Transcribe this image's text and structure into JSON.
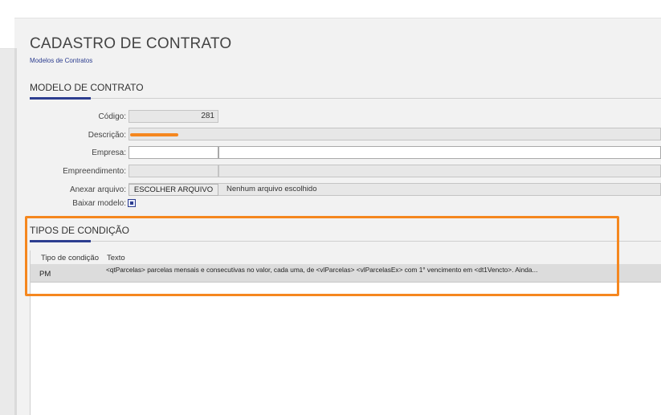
{
  "page": {
    "title": "CADASTRO DE CONTRATO",
    "breadcrumb": "Modelos de Contratos"
  },
  "modelo": {
    "section_title": "MODELO DE CONTRATO",
    "codigo_label": "Código:",
    "codigo_value": "281",
    "descricao_label": "Descrição:",
    "empresa_label": "Empresa:",
    "empreendimento_label": "Empreendimento:",
    "anexar_label": "Anexar arquivo:",
    "escolher_button": "ESCOLHER ARQUIVO",
    "file_status": "Nenhum arquivo escolhido",
    "baixar_label": "Baixar modelo:"
  },
  "tipos": {
    "section_title": "TIPOS DE CONDIÇÃO",
    "columns": [
      "Tipo de condição",
      "Texto"
    ],
    "rows": [
      {
        "tipo": "PM",
        "texto": "<qtParcelas> parcelas mensais e consecutivas no valor, cada uma, de <vlParcelas> <vlParcelasEx> com 1° vencimento em <dt1Vencto>. Ainda..."
      }
    ]
  },
  "colors": {
    "accent": "#2c3d8f",
    "highlight": "#f5871f",
    "redaction": "#f5871f"
  },
  "icons": {
    "download": "download-model-icon"
  }
}
